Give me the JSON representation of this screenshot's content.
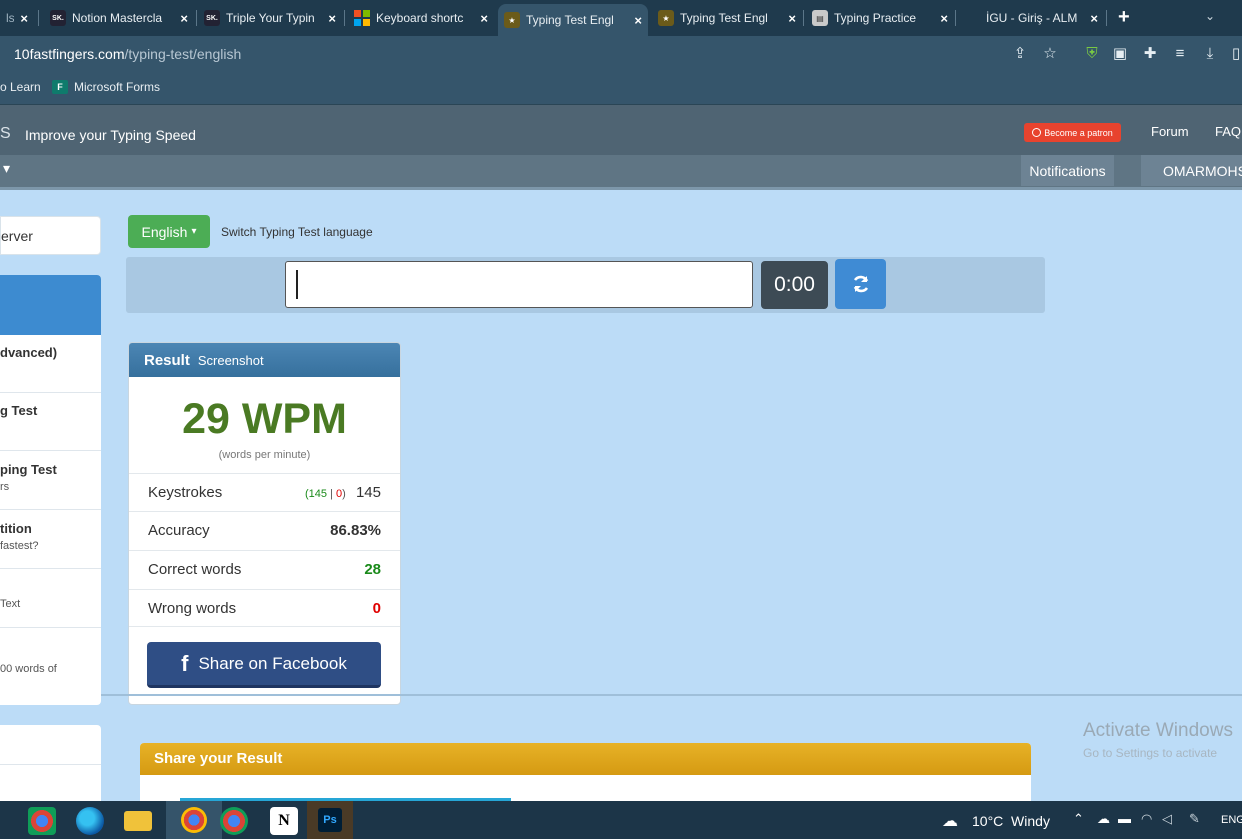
{
  "browser": {
    "tabs": [
      {
        "title": "ls",
        "favicon": "partial-tab",
        "active": false
      },
      {
        "title": "Notion Mastercla",
        "favicon": "sk-icon",
        "active": false
      },
      {
        "title": "Triple Your Typin",
        "favicon": "sk-icon",
        "active": false
      },
      {
        "title": "Keyboard shortc",
        "favicon": "microsoft-icon",
        "active": false
      },
      {
        "title": "Typing Test Engl",
        "favicon": "10ff-icon",
        "active": true
      },
      {
        "title": "Typing Test Engl",
        "favicon": "10ff-icon",
        "active": false
      },
      {
        "title": "Typing Practice",
        "favicon": "doc-icon",
        "active": false
      },
      {
        "title": "İGU - Giriş - ALM",
        "favicon": "blank",
        "active": false
      }
    ],
    "new_tab": "+",
    "url_host": "10fastfingers.com",
    "url_path": "/typing-test/english",
    "bookmarks": [
      {
        "label": "o Learn"
      },
      {
        "label": "Microsoft Forms"
      }
    ]
  },
  "site": {
    "logo_fragment": "S",
    "tagline": "Improve your Typing Speed",
    "patron_label": "Become a patron",
    "nav": [
      "Forum",
      "FAQ"
    ],
    "notifications_label": "Notifications",
    "username": "OMARMOHS",
    "dropdown_caret": "▾"
  },
  "sidebar": {
    "server_label": "erver",
    "items": [
      {
        "title": "dvanced)",
        "subtitle": ""
      },
      {
        "title": "g Test",
        "subtitle": ""
      },
      {
        "title": "ping Test",
        "subtitle": "rs"
      },
      {
        "title": "tition",
        "subtitle": "fastest?"
      },
      {
        "title": "",
        "subtitle": "Text"
      },
      {
        "title": "",
        "subtitle": "00 words of"
      }
    ]
  },
  "test": {
    "language_button": "English",
    "language_caption": "Switch Typing Test language",
    "input_value": "",
    "timer": "0:00",
    "reload_icon": "refresh-icon"
  },
  "result": {
    "header": "Result",
    "header_link": "Screenshot",
    "wpm": "29 WPM",
    "wpm_caption": "(words per minute)",
    "rows": [
      {
        "label": "Keystrokes",
        "detail_open": "(",
        "detail_correct": "145",
        "detail_sep": " | ",
        "detail_wrong": "0",
        "detail_close": ")",
        "value": "145"
      },
      {
        "label": "Accuracy",
        "value": "86.83%"
      },
      {
        "label": "Correct words",
        "value": "28"
      },
      {
        "label": "Wrong words",
        "value": "0"
      }
    ],
    "share_button": "Share on Facebook"
  },
  "share_panel": {
    "title": "Share your Result"
  },
  "watermark": {
    "title": "Activate Windows",
    "subtitle": "Go to Settings to activate"
  },
  "taskbar": {
    "weather": "10°C  Windy",
    "language": "ENG",
    "apps": [
      "chrome-icon",
      "edge-icon",
      "explorer-icon",
      "chrome-icon",
      "chrome-icon",
      "notion-icon",
      "photoshop-icon"
    ]
  },
  "colors": {
    "green": "#4cad55",
    "wpm_green": "#4a7a23",
    "blue": "#3f8bd4",
    "facebook": "#2f4e85",
    "wrong_red": "#e00000",
    "correct_green": "#1a8a1a"
  }
}
